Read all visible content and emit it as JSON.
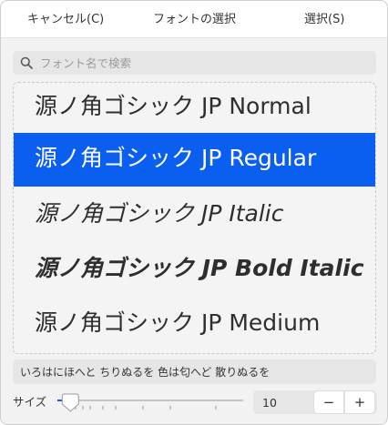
{
  "header": {
    "cancel_label": "キャンセル(C)",
    "title": "フォントの選択",
    "select_label": "選択(S)"
  },
  "search": {
    "placeholder": "フォント名で検索",
    "icon": "search-icon"
  },
  "font_list": {
    "selected_index": 1,
    "selected_color": "#0a5ff0",
    "items": [
      {
        "label": "源ノ角ゴシック JP Normal",
        "style": "normal"
      },
      {
        "label": "源ノ角ゴシック JP Regular",
        "style": "regular"
      },
      {
        "label": "源ノ角ゴシック JP Italic",
        "style": "italic"
      },
      {
        "label": "源ノ角ゴシック JP Bold Italic",
        "style": "bold-italic"
      },
      {
        "label": "源ノ角ゴシック JP Medium",
        "style": "medium"
      }
    ]
  },
  "preview": {
    "text": "いろはにほへと ちりぬるを 色は匂へど 散りぬるを"
  },
  "size": {
    "label": "サイズ",
    "value": "10",
    "minus": "−",
    "plus": "+",
    "slider_fraction": 0.07
  }
}
